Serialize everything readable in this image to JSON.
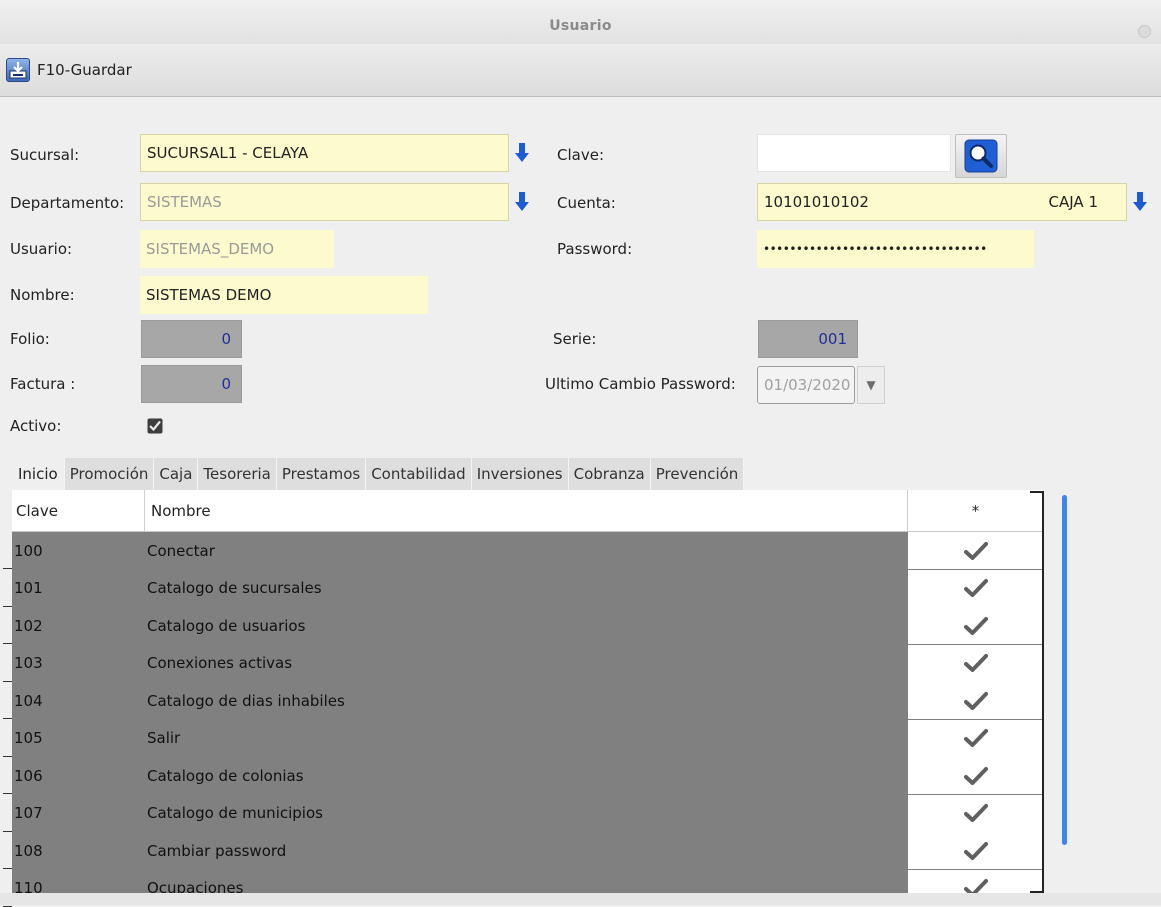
{
  "window": {
    "title": "Usuario"
  },
  "toolbar": {
    "save_label": "F10-Guardar"
  },
  "form": {
    "sucursal_label": "Sucursal:",
    "sucursal_value": "SUCURSAL1 - CELAYA",
    "departamento_label": "Departamento:",
    "departamento_value": "SISTEMAS",
    "usuario_label": "Usuario:",
    "usuario_value": "SISTEMAS_DEMO",
    "nombre_label": "Nombre:",
    "nombre_value": "SISTEMAS DEMO",
    "folio_label": "Folio:",
    "folio_value": "0",
    "factura_label": "Factura :",
    "factura_value": "0",
    "activo_label": "Activo:",
    "activo_checked": true,
    "clave_label": "Clave:",
    "clave_value": "",
    "cuenta_label": "Cuenta:",
    "cuenta_value": "10101010102",
    "cuenta_name": "CAJA 1",
    "password_label": "Password:",
    "password_value": "••••••••••••••••••••••••••••••••••",
    "serie_label": "Serie:",
    "serie_value": "001",
    "ultimo_cambio_label": "Ultimo Cambio Password:",
    "ultimo_cambio_value": "01/03/2020"
  },
  "tabs": [
    {
      "label": "Inicio",
      "active": true
    },
    {
      "label": "Promoción"
    },
    {
      "label": "Caja"
    },
    {
      "label": "Tesoreria"
    },
    {
      "label": "Prestamos"
    },
    {
      "label": "Contabilidad"
    },
    {
      "label": "Inversiones"
    },
    {
      "label": "Cobranza"
    },
    {
      "label": "Prevención"
    }
  ],
  "grid": {
    "headers": {
      "clave": "Clave",
      "nombre": "Nombre",
      "star": "*"
    },
    "rows": [
      {
        "clave": "100",
        "nombre": "Conectar",
        "checked": true
      },
      {
        "clave": "101",
        "nombre": "Catalogo de sucursales",
        "checked": true
      },
      {
        "clave": "102",
        "nombre": "Catalogo de usuarios",
        "checked": true
      },
      {
        "clave": "103",
        "nombre": "Conexiones activas",
        "checked": true
      },
      {
        "clave": "104",
        "nombre": "Catalogo de dias inhabiles",
        "checked": true
      },
      {
        "clave": "105",
        "nombre": "Salir",
        "checked": true
      },
      {
        "clave": "106",
        "nombre": "Catalogo de colonias",
        "checked": true
      },
      {
        "clave": "107",
        "nombre": "Catalogo de municipios",
        "checked": true
      },
      {
        "clave": "108",
        "nombre": "Cambiar password",
        "checked": true
      },
      {
        "clave": "110",
        "nombre": "Ocupaciones",
        "checked": true
      }
    ]
  },
  "colors": {
    "field_yellow": "#fdfacd",
    "field_gray": "#a7a7a7",
    "grid_gray": "#808080",
    "arrow_blue": "#1d5bd6",
    "scroll_blue": "#3a86ee"
  }
}
